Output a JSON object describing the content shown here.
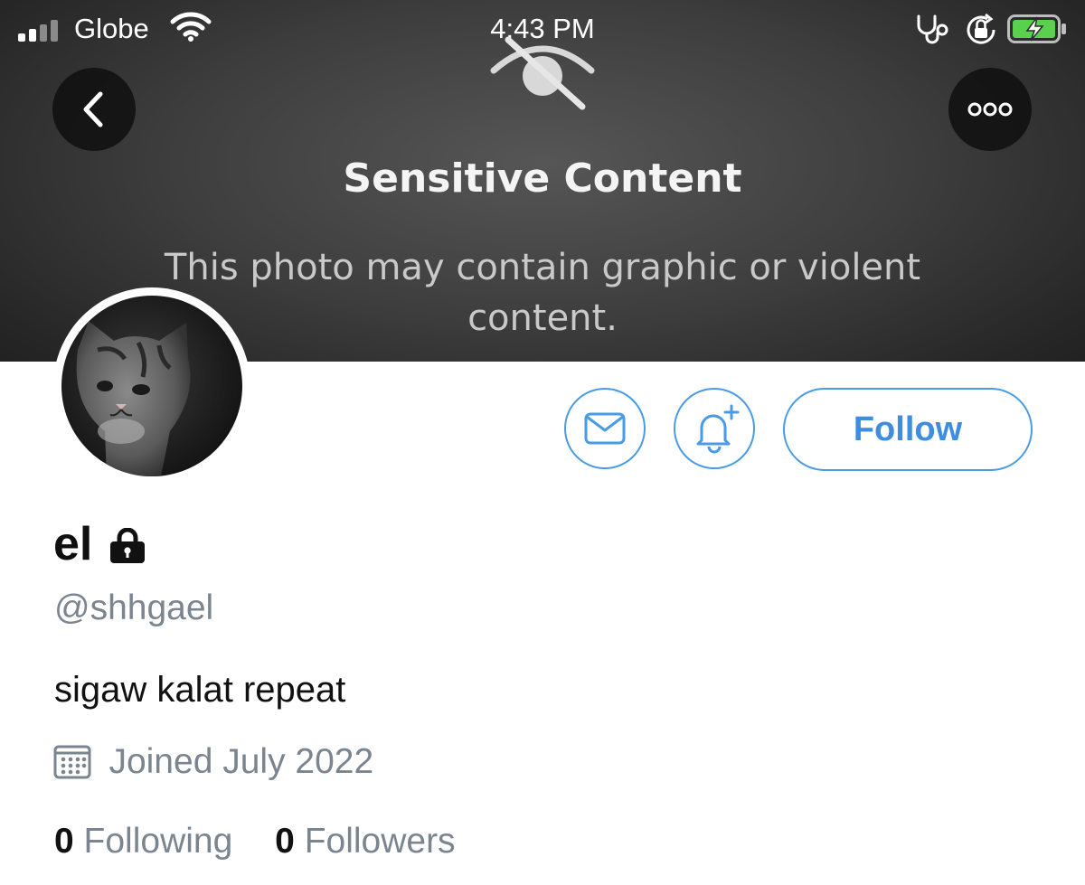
{
  "status_bar": {
    "carrier": "Globe",
    "time": "4:43 PM"
  },
  "banner": {
    "title": "Sensitive Content",
    "description": "This photo may contain graphic or violent content."
  },
  "actions": {
    "follow_label": "Follow"
  },
  "profile": {
    "name": "el",
    "handle": "@shhgael",
    "bio": "sigaw kalat repeat",
    "joined": "Joined July 2022"
  },
  "stats": {
    "following_count": "0",
    "following_label": "Following",
    "followers_count": "0",
    "followers_label": "Followers"
  },
  "colors": {
    "accent": "#4a9be6",
    "secondary_text": "#7b8590",
    "banner_dark": "#2a2a2a"
  },
  "icons": [
    "signal-icon",
    "wifi-icon",
    "stethoscope-icon",
    "rotation-lock-icon",
    "battery-icon",
    "back-arrow-icon",
    "more-options-icon",
    "eye-off-icon",
    "mail-icon",
    "bell-plus-icon",
    "lock-icon",
    "calendar-icon"
  ]
}
